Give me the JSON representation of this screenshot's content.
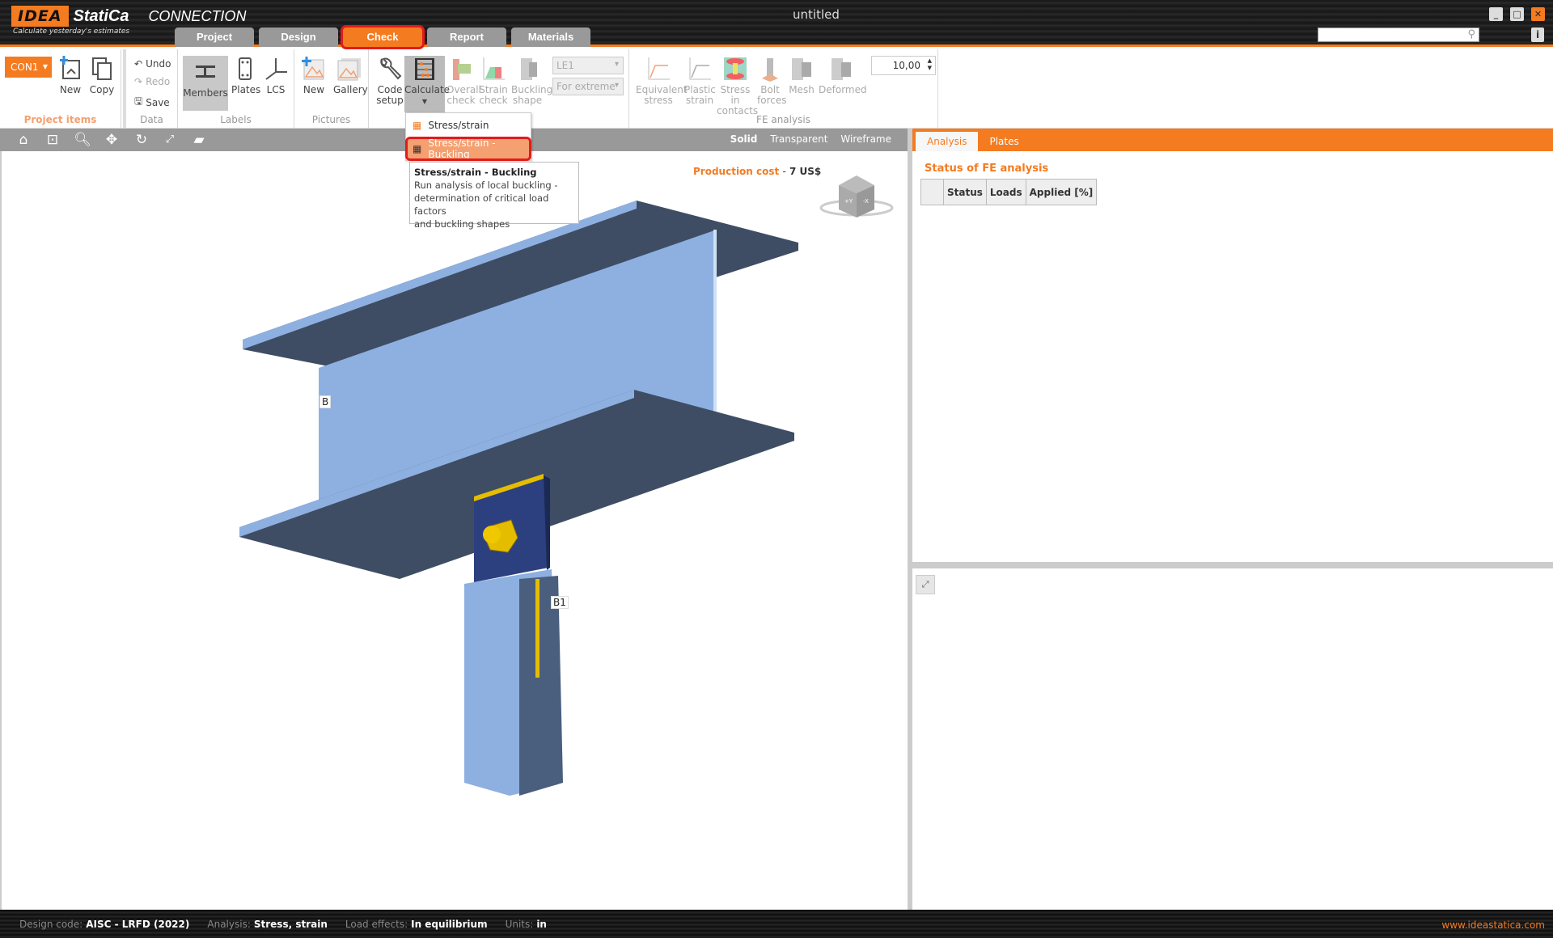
{
  "app": {
    "logo_mark": "IDEA",
    "logo_name": "StatiCa",
    "product": "CONNECTION",
    "slogan": "Calculate yesterday's estimates",
    "window_title": "untitled",
    "min_glyph": "_",
    "max_glyph": "□",
    "close_glyph": "✕",
    "info_glyph": "i",
    "search_placeholder": ""
  },
  "tabs": [
    {
      "label": "Project",
      "active": false
    },
    {
      "label": "Design",
      "active": false
    },
    {
      "label": "Check",
      "active": true
    },
    {
      "label": "Report",
      "active": false
    },
    {
      "label": "Materials",
      "active": false
    }
  ],
  "ribbon": {
    "project_items": {
      "selector": "CON1",
      "new": "New",
      "copy": "Copy",
      "label": "Project items"
    },
    "data": {
      "undo": "Undo",
      "redo": "Redo",
      "save": "Save",
      "label": "Data"
    },
    "labels": {
      "members": "Members",
      "plates": "Plates",
      "lcs": "LCS",
      "label": "Labels"
    },
    "pictures": {
      "new": "New",
      "gallery": "Gallery",
      "label": "Pictures"
    },
    "check": {
      "code_setup": [
        "Code",
        "setup"
      ],
      "calculate": "Calculate",
      "overall_check": [
        "Overall",
        "check"
      ],
      "strain_check": [
        "Strain",
        "check"
      ],
      "buckling_shape": [
        "Buckling",
        "shape"
      ],
      "load_combo": "LE1",
      "extreme_combo": "For extreme"
    },
    "fe_analysis": {
      "equivalent_stress": [
        "Equivalent",
        "stress"
      ],
      "plastic_strain": [
        "Plastic",
        "strain"
      ],
      "stress_in_contacts": [
        "Stress in",
        "contacts"
      ],
      "bolt_forces": [
        "Bolt",
        "forces"
      ],
      "mesh": "Mesh",
      "deformed": "Deformed",
      "scale_value": "10,00",
      "label": "FE analysis"
    }
  },
  "calculate_menu": {
    "items": [
      {
        "label": "Stress/strain",
        "selected": false
      },
      {
        "label": "Stress/strain - Buckling",
        "selected": true
      }
    ],
    "tooltip_title": "Stress/strain - Buckling",
    "tooltip_lines": [
      "Run analysis of local buckling -",
      "determination of critical load factors",
      "and buckling shapes"
    ]
  },
  "viewbar": {
    "modes": [
      {
        "label": "Solid",
        "active": true
      },
      {
        "label": "Transparent",
        "active": false
      },
      {
        "label": "Wireframe",
        "active": false
      }
    ]
  },
  "viewport": {
    "production_cost_label": "Production cost",
    "production_cost_sep": "-",
    "production_cost_value": "7 US$",
    "member_labels": [
      "B",
      "B1"
    ],
    "cube_faces": [
      "+Y",
      "-X"
    ]
  },
  "right_panel": {
    "tabs": [
      {
        "label": "Analysis",
        "active": true
      },
      {
        "label": "Plates",
        "active": false
      }
    ],
    "fe_title": "Status of FE analysis",
    "table_headers": [
      "",
      "Status",
      "Loads",
      "Applied [%]"
    ]
  },
  "statusbar": [
    {
      "key": "Design code:",
      "value": "AISC - LRFD (2022)"
    },
    {
      "key": "Analysis:",
      "value": "Stress, strain"
    },
    {
      "key": "Load effects:",
      "value": "In equilibrium"
    },
    {
      "key": "Units:",
      "value": "in"
    }
  ],
  "website": {
    "main": "www.ideastatica",
    "tld": ".com"
  },
  "colors": {
    "accent": "#f47b20",
    "highlight": "#e21b1b",
    "steel_light": "#8db0e0",
    "steel_dark": "#3e4d63",
    "plate": "#2c4080",
    "bolt": "#e5bd00"
  }
}
